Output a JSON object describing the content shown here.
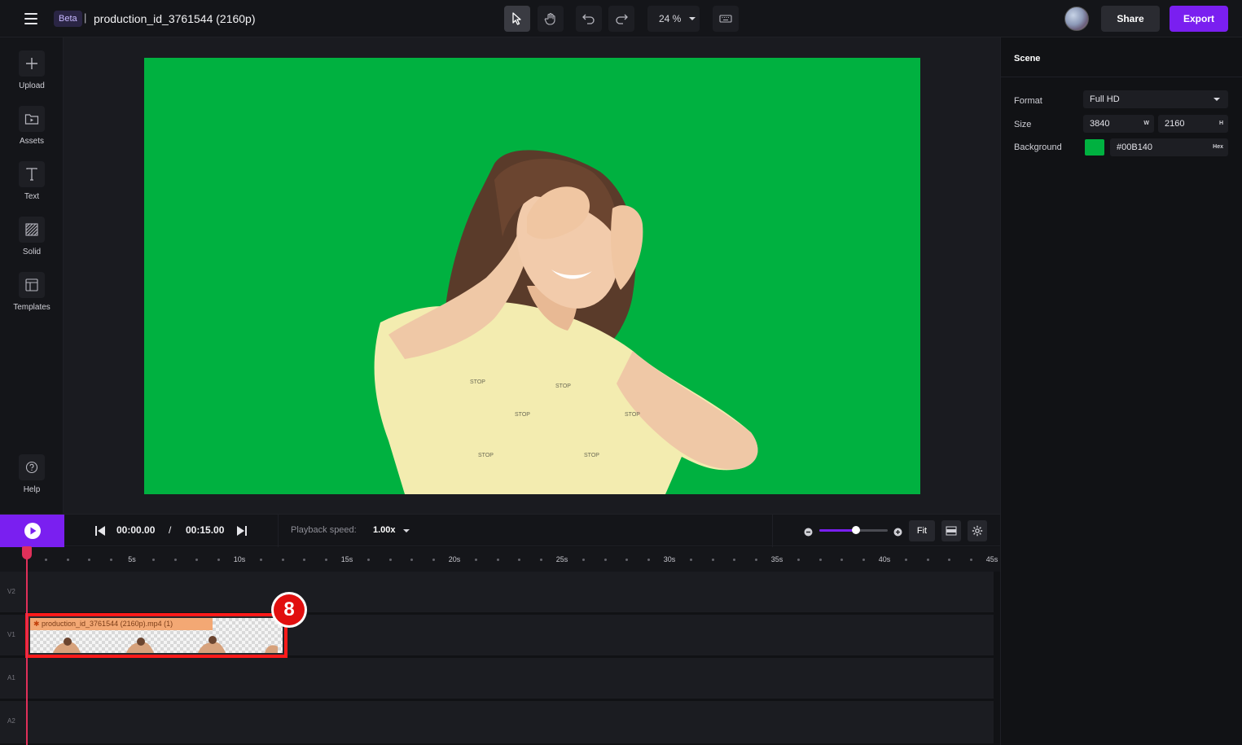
{
  "header": {
    "badge": "Beta",
    "separator": "|",
    "project_title": "production_id_3761544 (2160p)",
    "zoom_level": "24 %",
    "share_label": "Share",
    "export_label": "Export"
  },
  "sidebar": {
    "items": [
      {
        "label": "Upload",
        "icon": "plus-icon"
      },
      {
        "label": "Assets",
        "icon": "folder-play-icon"
      },
      {
        "label": "Text",
        "icon": "text-icon"
      },
      {
        "label": "Solid",
        "icon": "hatched-square-icon"
      },
      {
        "label": "Templates",
        "icon": "layout-icon"
      }
    ],
    "help_label": "Help"
  },
  "scene_panel": {
    "heading": "Scene",
    "format_label": "Format",
    "format_value": "Full HD",
    "size_label": "Size",
    "width_value": "3840",
    "width_unit": "W",
    "height_value": "2160",
    "height_unit": "H",
    "background_label": "Background",
    "background_hex": "#00B140",
    "background_unit": "Hex"
  },
  "playback": {
    "current_time": "00:00.00",
    "time_separator": "/",
    "total_time": "00:15.00",
    "speed_label": "Playback speed:",
    "speed_value": "1.00x",
    "fit_label": "Fit",
    "timeline_zoom_fraction": 0.53
  },
  "timeline": {
    "ruler_labels": [
      "5s",
      "10s",
      "15s",
      "20s",
      "25s",
      "30s",
      "35s",
      "40s",
      "45s"
    ],
    "tracks": [
      "V2",
      "V1",
      "A1",
      "A2"
    ],
    "clip": {
      "label": "production_id_3761544 (2160p).mp4 (1)"
    },
    "annotation_badge": "8"
  },
  "colors": {
    "accent": "#7a1ff0",
    "canvas_background": "#00B140",
    "highlight_border": "#ff1a1a",
    "playhead": "#e0305a"
  }
}
